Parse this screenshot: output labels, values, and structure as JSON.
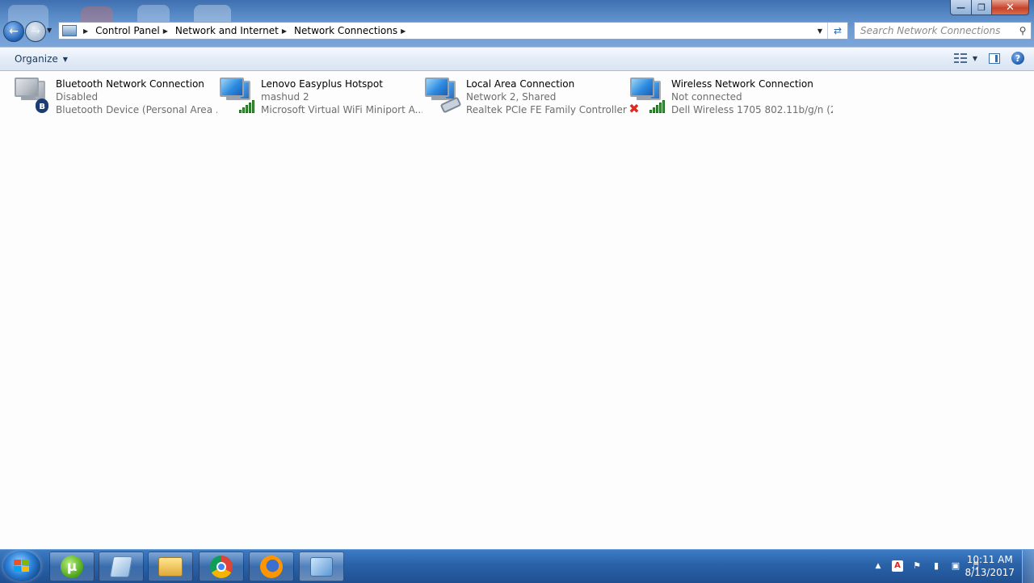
{
  "window": {
    "caption": {
      "minimize": "—",
      "maximize": "❐",
      "close": "✕"
    }
  },
  "nav": {
    "back_icon": "arrow-left-icon",
    "forward_icon": "arrow-right-icon"
  },
  "address": {
    "breadcrumbs": [
      "Control Panel",
      "Network and Internet",
      "Network Connections"
    ]
  },
  "search": {
    "placeholder": "Search Network Connections"
  },
  "toolbar": {
    "organize_label": "Organize"
  },
  "connections": [
    {
      "name": "Bluetooth Network Connection",
      "status": "Disabled",
      "device": "Bluetooth Device (Personal Area ...",
      "icon": "bluetooth-network-icon"
    },
    {
      "name": "Lenovo Easyplus Hotspot",
      "status": "mashud  2",
      "device": "Microsoft Virtual WiFi Miniport A...",
      "icon": "wifi-network-icon"
    },
    {
      "name": "Local Area Connection",
      "status": "Network  2, Shared",
      "device": "Realtek PCIe FE Family Controller",
      "icon": "ethernet-network-icon"
    },
    {
      "name": "Wireless Network Connection",
      "status": "Not connected",
      "device": "Dell Wireless 1705 802.11b/g/n (2....",
      "icon": "wireless-disconnected-icon"
    }
  ],
  "taskbar": {
    "apps": [
      "uTorrent",
      "Notepad",
      "Windows Explorer",
      "Google Chrome",
      "Firefox",
      "Network Connections"
    ],
    "clock": {
      "time": "10:11 AM",
      "date": "8/13/2017"
    }
  },
  "colors": {
    "accent": "#1f5fb3",
    "taskbar": "#2a62a8",
    "status_text": "#6d6d6d"
  }
}
